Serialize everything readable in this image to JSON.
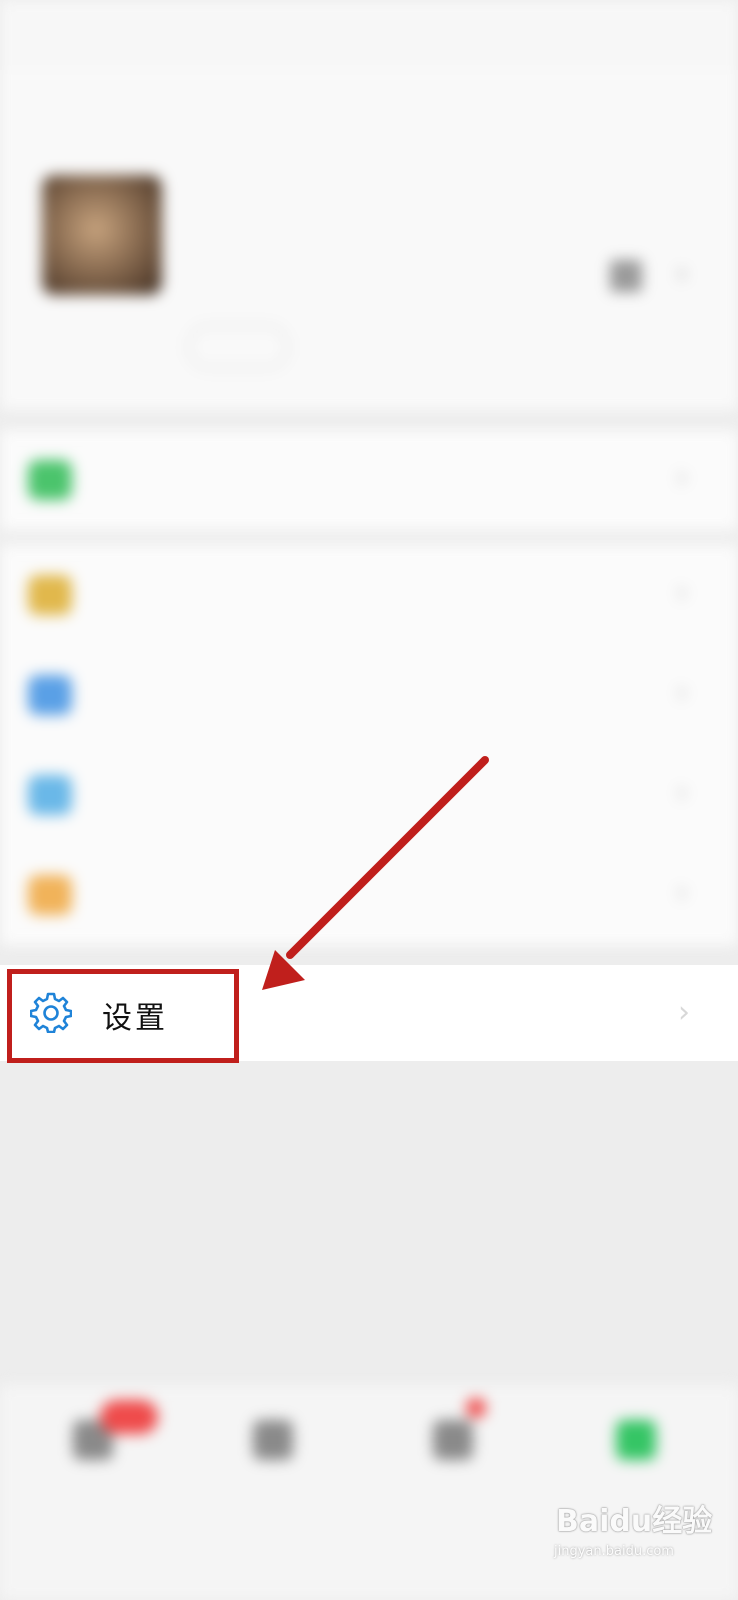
{
  "statusbar": {
    "left": "",
    "right": ""
  },
  "profile": {
    "nickname": "",
    "wechat_id": "",
    "status": ""
  },
  "menu": {
    "items": [
      {
        "label": "",
        "icon": "pay-icon",
        "color": "#4bc46c"
      },
      {
        "label": "",
        "icon": "favorites-icon",
        "color": "#e1b84c"
      },
      {
        "label": "",
        "icon": "moments-icon",
        "color": "#5aa0e6"
      },
      {
        "label": "",
        "icon": "cards-icon",
        "color": "#6ab8e8"
      },
      {
        "label": "",
        "icon": "stickers-icon",
        "color": "#f1b35a"
      }
    ],
    "settings": {
      "label": "设置",
      "icon": "gear-icon",
      "color": "#1f83d8"
    }
  },
  "tabbar": {
    "tabs": [
      {
        "label": "",
        "icon": "chats-icon"
      },
      {
        "label": "",
        "icon": "contacts-icon"
      },
      {
        "label": "",
        "icon": "discover-icon"
      },
      {
        "label": "",
        "icon": "me-icon",
        "active": true,
        "color": "#35c565"
      }
    ]
  },
  "annotation": {
    "highlight_color": "#c01f1c"
  },
  "watermark": {
    "brand": "Baidu经验",
    "url": "jingyan.baidu.com"
  }
}
